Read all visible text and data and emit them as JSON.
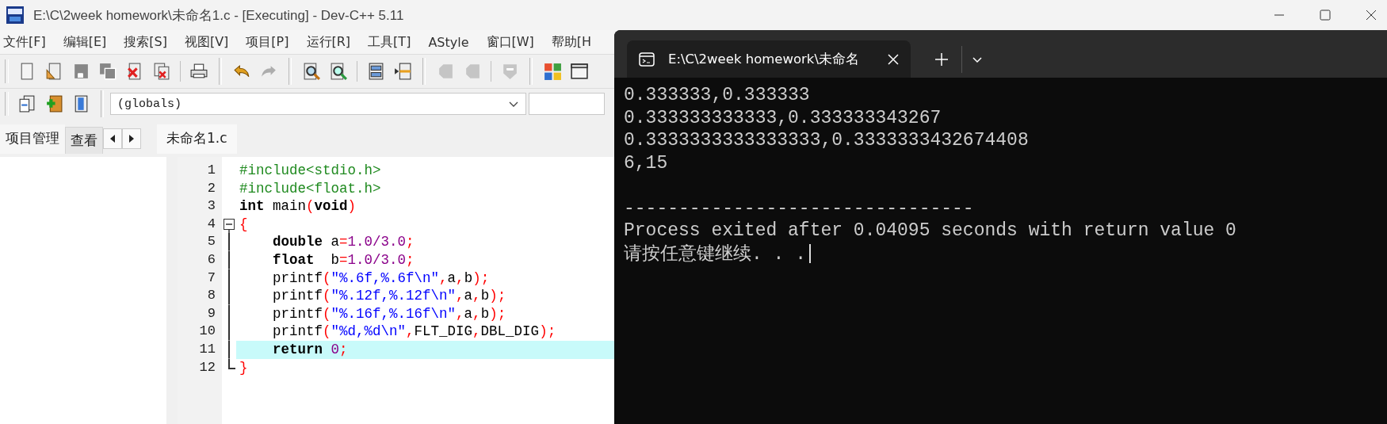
{
  "window": {
    "title": "E:\\C\\2week homework\\未命名1.c - [Executing] - Dev-C++ 5.11"
  },
  "menu": [
    "文件[F]",
    "编辑[E]",
    "搜索[S]",
    "视图[V]",
    "项目[P]",
    "运行[R]",
    "工具[T]",
    "AStyle",
    "窗口[W]",
    "帮助[H"
  ],
  "toolbar": {
    "row_1": [
      {
        "disabled": false
      },
      {
        "disabled": false
      },
      {
        "disabled": true
      },
      {
        "disabled": true
      },
      {
        "disabled": false
      },
      {
        "disabled": false
      },
      {
        "disabled": false
      },
      {
        "disabled": false
      },
      {
        "disabled": true
      },
      {
        "disabled": false
      },
      {
        "disabled": false
      },
      {
        "disabled": false
      },
      {
        "disabled": false
      },
      {
        "disabled": true
      },
      {
        "disabled": true
      },
      {
        "disabled": true
      },
      {
        "disabled": false
      },
      {
        "disabled": false
      }
    ],
    "row_2": [
      {
        "disabled": false
      },
      {
        "disabled": false
      },
      {
        "disabled": false
      }
    ]
  },
  "scope_combo": {
    "value": "(globals)"
  },
  "side_tabs": [
    {
      "label": "项目管理",
      "selected": true
    },
    {
      "label": "查看",
      "selected": false
    }
  ],
  "editor_tabs": [
    {
      "label": "未命名1.c",
      "selected": true
    }
  ],
  "code": [
    {
      "number": "1",
      "kind": "plain",
      "highlighted": false,
      "tokens": [
        {
          "kind": "pre",
          "text": "#include<stdio.h>"
        }
      ]
    },
    {
      "number": "2",
      "kind": "plain",
      "highlighted": false,
      "tokens": [
        {
          "kind": "pre",
          "text": "#include<float.h>"
        }
      ]
    },
    {
      "number": "3",
      "kind": "plain",
      "highlighted": false,
      "tokens": [
        {
          "kind": "kw",
          "text": "int"
        },
        {
          "kind": "id",
          "text": " main"
        },
        {
          "kind": "sym",
          "text": "("
        },
        {
          "kind": "kw",
          "text": "void"
        },
        {
          "kind": "sym",
          "text": ")"
        }
      ]
    },
    {
      "number": "4",
      "kind": "foldstart",
      "highlighted": false,
      "tokens": [
        {
          "kind": "sym",
          "text": "{"
        }
      ]
    },
    {
      "number": "5",
      "kind": "foldbody",
      "highlighted": false,
      "tokens": [
        {
          "kind": "kw",
          "text": "    double"
        },
        {
          "kind": "id",
          "text": " a"
        },
        {
          "kind": "sym",
          "text": "="
        },
        {
          "kind": "num",
          "text": "1.0/3.0"
        },
        {
          "kind": "sym",
          "text": ";"
        }
      ]
    },
    {
      "number": "6",
      "kind": "foldbody",
      "highlighted": false,
      "tokens": [
        {
          "kind": "kw",
          "text": "    float"
        },
        {
          "kind": "id",
          "text": "  b"
        },
        {
          "kind": "sym",
          "text": "="
        },
        {
          "kind": "num",
          "text": "1.0/3.0"
        },
        {
          "kind": "sym",
          "text": ";"
        }
      ]
    },
    {
      "number": "7",
      "kind": "foldbody",
      "highlighted": false,
      "tokens": [
        {
          "kind": "id",
          "text": "    printf"
        },
        {
          "kind": "sym",
          "text": "("
        },
        {
          "kind": "str",
          "text": "\"%.6f,%.6f\\n\""
        },
        {
          "kind": "sym",
          "text": ","
        },
        {
          "kind": "id",
          "text": "a"
        },
        {
          "kind": "sym",
          "text": ","
        },
        {
          "kind": "id",
          "text": "b"
        },
        {
          "kind": "sym",
          "text": ");"
        }
      ]
    },
    {
      "number": "8",
      "kind": "foldbody",
      "highlighted": false,
      "tokens": [
        {
          "kind": "id",
          "text": "    printf"
        },
        {
          "kind": "sym",
          "text": "("
        },
        {
          "kind": "str",
          "text": "\"%.12f,%.12f\\n\""
        },
        {
          "kind": "sym",
          "text": ","
        },
        {
          "kind": "id",
          "text": "a"
        },
        {
          "kind": "sym",
          "text": ","
        },
        {
          "kind": "id",
          "text": "b"
        },
        {
          "kind": "sym",
          "text": ");"
        }
      ]
    },
    {
      "number": "9",
      "kind": "foldbody",
      "highlighted": false,
      "tokens": [
        {
          "kind": "id",
          "text": "    printf"
        },
        {
          "kind": "sym",
          "text": "("
        },
        {
          "kind": "str",
          "text": "\"%.16f,%.16f\\n\""
        },
        {
          "kind": "sym",
          "text": ","
        },
        {
          "kind": "id",
          "text": "a"
        },
        {
          "kind": "sym",
          "text": ","
        },
        {
          "kind": "id",
          "text": "b"
        },
        {
          "kind": "sym",
          "text": ");"
        }
      ]
    },
    {
      "number": "10",
      "kind": "foldbody",
      "highlighted": false,
      "tokens": [
        {
          "kind": "id",
          "text": "    printf"
        },
        {
          "kind": "sym",
          "text": "("
        },
        {
          "kind": "str",
          "text": "\"%d,%d\\n\""
        },
        {
          "kind": "sym",
          "text": ","
        },
        {
          "kind": "id",
          "text": "FLT_DIG"
        },
        {
          "kind": "sym",
          "text": ","
        },
        {
          "kind": "id",
          "text": "DBL_DIG"
        },
        {
          "kind": "sym",
          "text": ");"
        }
      ]
    },
    {
      "number": "11",
      "kind": "foldbody",
      "highlighted": true,
      "tokens": [
        {
          "kind": "kw",
          "text": "    return"
        },
        {
          "kind": "num",
          "text": " 0"
        },
        {
          "kind": "sym",
          "text": ";"
        }
      ]
    },
    {
      "number": "12",
      "kind": "foldend",
      "highlighted": false,
      "tokens": [
        {
          "kind": "sym",
          "text": "}"
        }
      ]
    }
  ],
  "terminal": {
    "tab_title": "E:\\C\\2week homework\\未命名",
    "output": [
      "0.333333,0.333333",
      "0.333333333333,0.333333343267",
      "0.3333333333333333,0.3333333432674408",
      "6,15"
    ],
    "footer": [
      "--------------------------------",
      "Process exited after 0.04095 seconds with return value 0",
      "请按任意键继续. . ."
    ]
  }
}
